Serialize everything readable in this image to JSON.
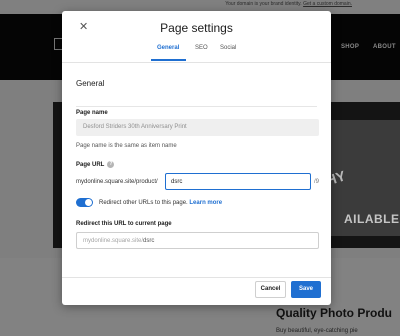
{
  "background": {
    "notice_text": "Your domain is your brand identity.",
    "notice_link": "Get a custom domain.",
    "nav": [
      "SHOP",
      "ABOUT"
    ],
    "sign_letters": "HY",
    "sign_text": "AILABLE",
    "heading": "Quality Photo Produ",
    "subtext": "Buy beautiful, eye-catching pie"
  },
  "modal": {
    "title": "Page settings",
    "tabs": [
      {
        "label": "General",
        "active": true
      },
      {
        "label": "SEO",
        "active": false
      },
      {
        "label": "Social",
        "active": false
      }
    ],
    "section_title": "General",
    "page_name": {
      "label": "Page name",
      "value": "Desford Striders 30th Anniversary Print",
      "help": "Page name is the same as item name"
    },
    "page_url": {
      "label": "Page URL",
      "prefix": "mydonline.square.site/product/",
      "value": "dsrc",
      "suffix": "/9"
    },
    "redirect_toggle": {
      "on": true,
      "label": "Redirect other URLs to this page.",
      "link": "Learn more"
    },
    "redirect_url": {
      "label": "Redirect this URL to current page",
      "placeholder": "mydonline.square.site/",
      "value": "dsrc"
    },
    "cancel_label": "Cancel",
    "save_label": "Save"
  },
  "colors": {
    "accent": "#1f6fd1",
    "overlay": "#7f7f7f"
  },
  "icons": {
    "close": "close-icon",
    "help": "help-circle-icon"
  }
}
